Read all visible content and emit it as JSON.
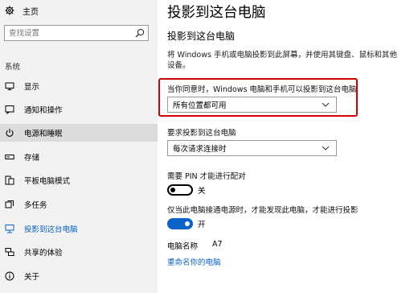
{
  "sidebar": {
    "home_label": "主页",
    "search_placeholder": "查找设置",
    "section_label": "系统",
    "items": [
      {
        "label": "显示",
        "icon": "monitor-icon"
      },
      {
        "label": "通知和操作",
        "icon": "notification-icon"
      },
      {
        "label": "电源和睡眠",
        "icon": "power-icon",
        "selected": true
      },
      {
        "label": "存储",
        "icon": "storage-icon"
      },
      {
        "label": "平板电脑模式",
        "icon": "tablet-icon"
      },
      {
        "label": "多任务",
        "icon": "multitask-icon"
      },
      {
        "label": "投影到这台电脑",
        "icon": "project-icon",
        "active": true
      },
      {
        "label": "共享的体验",
        "icon": "share-icon"
      },
      {
        "label": "关于",
        "icon": "info-icon"
      }
    ]
  },
  "main": {
    "title": "投影到这台电脑",
    "subtitle": "投影到这台电脑",
    "description": "将 Windows 手机或电脑投影到此屏幕，并使用其键盘、鼠标和其他设备。",
    "availability": {
      "label": "当你同意时，Windows 电脑和手机可以投影到这台电脑",
      "value": "所有位置都可用"
    },
    "ask_to_project": {
      "label": "要求投影到这台电脑",
      "value": "每次请求连接时"
    },
    "pin": {
      "label": "需要 PIN 才能进行配对",
      "state": "关"
    },
    "power_only": {
      "label": "仅当此电脑接通电源时，才能发现此电脑，才能进行投影",
      "state": "开"
    },
    "pc_name": {
      "label": "电脑名称",
      "value": "A7"
    },
    "rename_link": "重命名你的电脑"
  },
  "colors": {
    "accent": "#0a64c8",
    "highlight_border": "#d10000",
    "sidebar_bg": "#f2f2f2"
  }
}
